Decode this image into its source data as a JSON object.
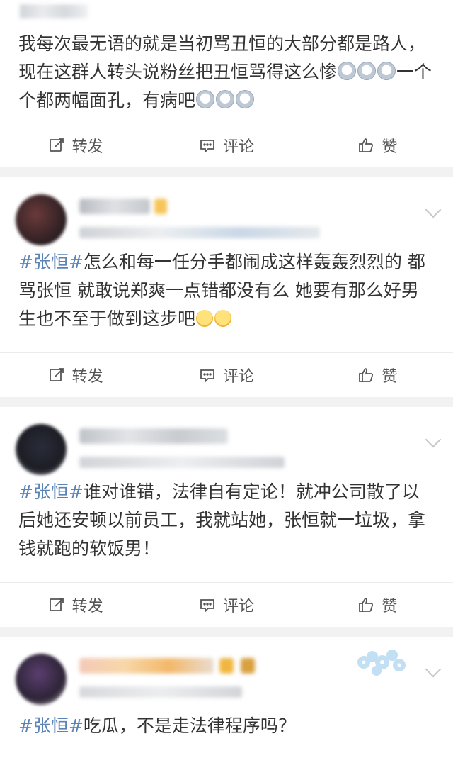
{
  "posts": [
    {
      "text_plain": "我每次最无语的就是当初骂丑恒的大部分都是路人，现在这群人转头说粉丝把丑恒骂得这么惨",
      "text_plain2": "一个个都两幅面孔，有病吧"
    },
    {
      "tag": "#张恒#",
      "text": "怎么和每一任分手都闹成这样轰轰烈烈的 都骂张恒 就敢说郑爽一点错都没有么 她要有那么好男生也不至于做到这步吧"
    },
    {
      "tag": "#张恒#",
      "text": "谁对谁错，法律自有定论！就冲公司散了以后她还安顿以前员工，我就站她，张恒就一垃圾，拿钱就跑的软饭男！"
    },
    {
      "tag": "#张恒#",
      "text": "吃瓜，不是走法律程序吗？"
    }
  ],
  "actions": {
    "forward": "转发",
    "comment": "评论",
    "like": "赞"
  },
  "icons": {
    "forward": "edit-share-icon",
    "comment": "comment-bubble-icon",
    "like": "thumbs-up-icon",
    "more": "chevron-down-icon"
  },
  "colors": {
    "hashtag": "#5b84b6",
    "text": "#333333",
    "background": "#f2f2f2"
  }
}
